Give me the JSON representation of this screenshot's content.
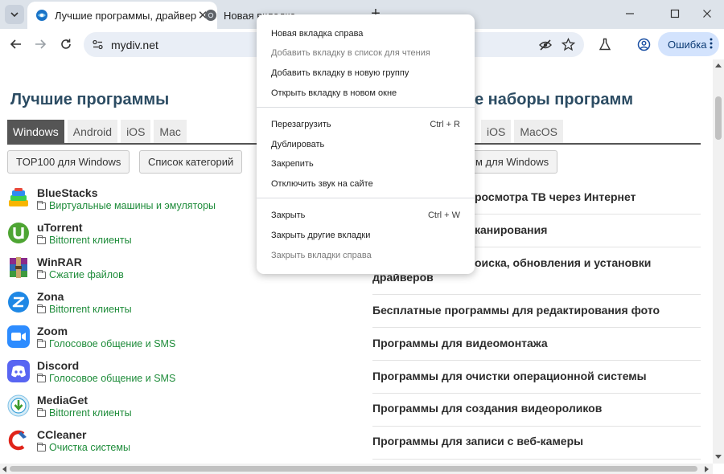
{
  "browser": {
    "tabs": [
      {
        "title": "Лучшие программы, драйвера"
      },
      {
        "title": "Новая вкладка"
      }
    ],
    "address": "mydiv.net",
    "profile_label": "Ошибка"
  },
  "left_column": {
    "title": "Лучшие программы",
    "tabs": [
      "Windows",
      "Android",
      "iOS",
      "Mac"
    ],
    "buttons": [
      "TOP100 для Windows",
      "Список категорий"
    ],
    "programs": [
      {
        "name": "BlueStacks",
        "category": "Виртуальные машины и эмуляторы",
        "icon": "bluestacks-icon"
      },
      {
        "name": "uTorrent",
        "category": "Bittorrent клиенты",
        "icon": "utorrent-icon"
      },
      {
        "name": "WinRAR",
        "category": "Сжатие файлов",
        "icon": "winrar-icon"
      },
      {
        "name": "Zona",
        "category": "Bittorrent клиенты",
        "icon": "zona-icon"
      },
      {
        "name": "Zoom",
        "category": "Голосовое общение и SMS",
        "icon": "zoom-icon"
      },
      {
        "name": "Discord",
        "category": "Голосовое общение и SMS",
        "icon": "discord-icon"
      },
      {
        "name": "MediaGet",
        "category": "Bittorrent клиенты",
        "icon": "mediaget-icon"
      },
      {
        "name": "CCleaner",
        "category": "Очистка системы",
        "icon": "ccleaner-icon"
      }
    ]
  },
  "right_column": {
    "title_visible": "е наборы программ",
    "tabs_visible": [
      "iOS",
      "MacOS"
    ],
    "button_visible": "м для Windows",
    "sets": [
      "росмотра ТВ через Интернет",
      "канирования",
      "оиска, обновления и установки драйверов",
      "Бесплатные программы для редактирования фото",
      "Программы для видеомонтажа",
      "Программы для очистки операционной системы",
      "Программы для создания видеороликов",
      "Программы для записи с веб-камеры"
    ]
  },
  "context_menu": {
    "groups": [
      [
        {
          "label": "Новая вкладка справа",
          "shortcut": "",
          "disabled": false
        },
        {
          "label": "Добавить вкладку в список для чтения",
          "shortcut": "",
          "disabled": true
        },
        {
          "label": "Добавить вкладку в новую группу",
          "shortcut": "",
          "disabled": false
        },
        {
          "label": "Открыть вкладку в новом окне",
          "shortcut": "",
          "disabled": false
        }
      ],
      [
        {
          "label": "Перезагрузить",
          "shortcut": "Ctrl + R",
          "disabled": false
        },
        {
          "label": "Дублировать",
          "shortcut": "",
          "disabled": false
        },
        {
          "label": "Закрепить",
          "shortcut": "",
          "disabled": false
        },
        {
          "label": "Отключить звук на сайте",
          "shortcut": "",
          "disabled": false
        }
      ],
      [
        {
          "label": "Закрыть",
          "shortcut": "Ctrl + W",
          "disabled": false
        },
        {
          "label": "Закрыть другие вкладки",
          "shortcut": "",
          "disabled": false
        },
        {
          "label": "Закрыть вкладки справа",
          "shortcut": "",
          "disabled": true
        }
      ]
    ]
  },
  "colors": {
    "title": "#2c4c63",
    "category_link": "#1e8c3a",
    "active_tab": "#555555",
    "tabstrip": "#dde3ea",
    "profile_chip": "#d3e3fd"
  }
}
